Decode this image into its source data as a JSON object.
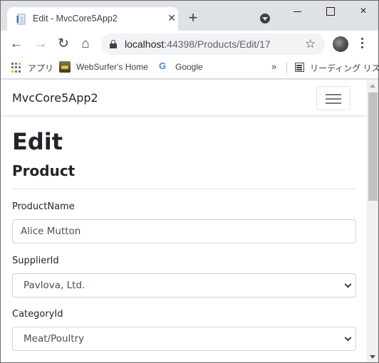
{
  "browser": {
    "tab": {
      "title": "Edit - MvcCore5App2",
      "favicon": "document-icon"
    },
    "new_tab_symbol": "+",
    "window_controls": {
      "minimize": "minimize-icon",
      "maximize": "maximize-icon",
      "close": "×"
    },
    "tab_close": "✕",
    "nav": {
      "back": "←",
      "forward": "→",
      "reload": "↻",
      "home": "⌂"
    },
    "address": {
      "host": "localhost",
      "path": ":44398/Products/Edit/17"
    },
    "star": "☆",
    "bookmarks": [
      {
        "label": "アプリ",
        "icon": "apps-grid-icon"
      },
      {
        "label": "WebSurfer's Home",
        "icon": "websurfer-icon"
      },
      {
        "label": "Google",
        "icon": "google-icon"
      }
    ],
    "google_glyph": "G",
    "overflow": "»",
    "reading_list": "リーディング リスト"
  },
  "page": {
    "brand": "MvcCore5App2",
    "title": "Edit",
    "subtitle": "Product",
    "form": {
      "fields": [
        {
          "label": "ProductName",
          "type": "text",
          "value": "Alice Mutton"
        },
        {
          "label": "SupplierId",
          "type": "select",
          "value": "Pavlova, Ltd."
        },
        {
          "label": "CategoryId",
          "type": "select",
          "value": "Meat/Poultry"
        }
      ]
    }
  },
  "colors": {
    "apps_grid": [
      "#ea4335",
      "#4285f4",
      "#fbbc05",
      "#34a853",
      "#ea4335",
      "#4285f4",
      "#fbbc05",
      "#34a853",
      "#ea4335"
    ]
  }
}
